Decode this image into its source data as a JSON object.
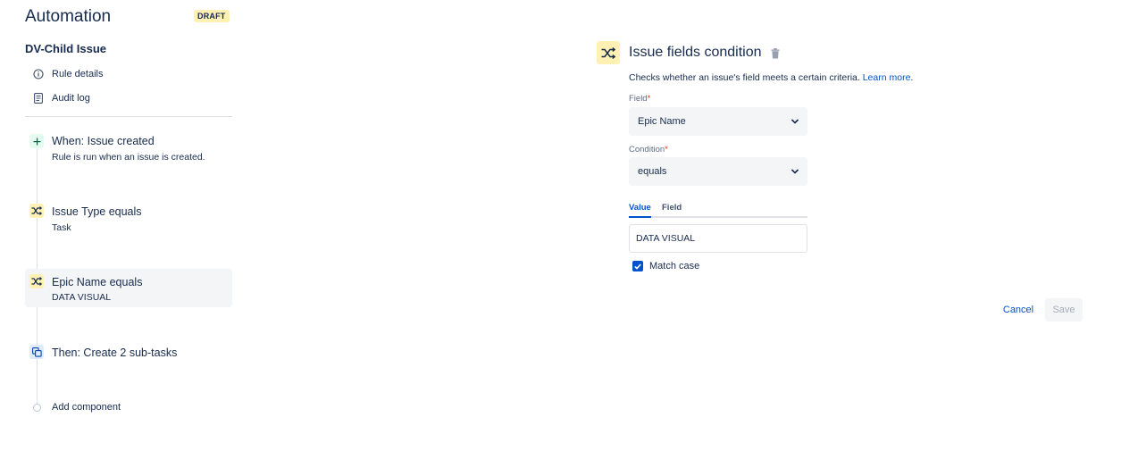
{
  "app": {
    "title": "Automation",
    "badge": "DRAFT"
  },
  "rule": {
    "name": "DV-Child Issue"
  },
  "sidebar": {
    "links": [
      {
        "label": "Rule details",
        "icon": "info-icon"
      },
      {
        "label": "Audit log",
        "icon": "document-icon"
      }
    ],
    "steps": [
      {
        "title": "When: Issue created",
        "subtitle": "Rule is run when an issue is created.",
        "icon": "plus-icon",
        "kind": "trigger"
      },
      {
        "title": "Issue Type equals",
        "subtitle": "Task",
        "icon": "shuffle-icon",
        "kind": "condition"
      },
      {
        "title": "Epic Name equals",
        "subtitle": "DATA VISUAL",
        "icon": "shuffle-icon",
        "kind": "condition",
        "selected": true
      },
      {
        "title": "Then: Create 2 sub-tasks",
        "icon": "subtasks-icon",
        "kind": "action"
      }
    ],
    "add_component": "Add component"
  },
  "panel": {
    "title": "Issue fields condition",
    "description": "Checks whether an issue's field meets a certain criteria.",
    "learn_more": "Learn more.",
    "field_label": "Field",
    "field_value": "Epic Name",
    "condition_label": "Condition",
    "condition_value": "equals",
    "required_mark": "*",
    "tabs": [
      "Value",
      "Field"
    ],
    "active_tab": "Value",
    "value_input": "DATA VISUAL",
    "match_case_label": "Match case",
    "match_case_checked": true
  },
  "actions": {
    "cancel": "Cancel",
    "save": "Save"
  },
  "colors": {
    "accent": "#0052cc",
    "condition_icon_bg": "#fff0b3",
    "trigger_icon_bg": "#e3fcef",
    "action_icon_bg": "#deebff",
    "selected_bg": "#f4f5f7"
  }
}
